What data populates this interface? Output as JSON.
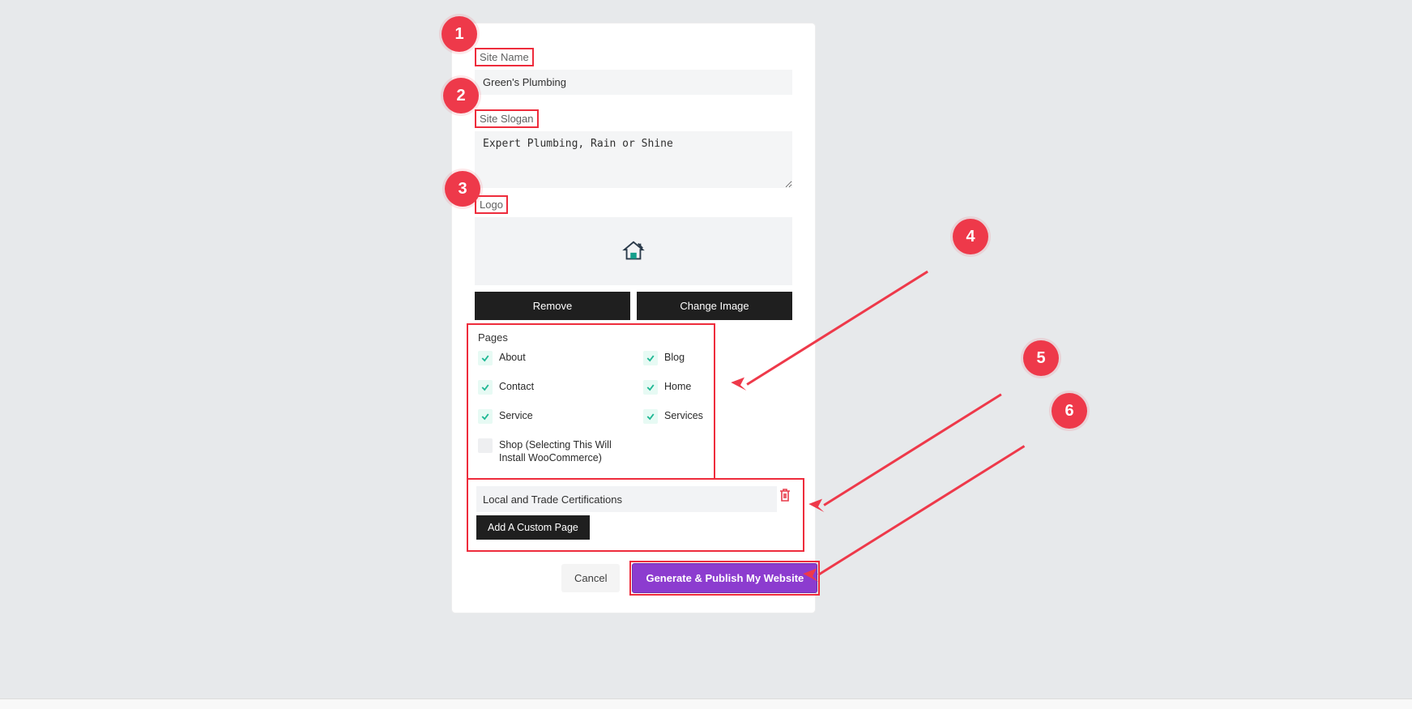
{
  "labels": {
    "site_name": "Site Name",
    "site_slogan": "Site Slogan",
    "logo": "Logo",
    "pages": "Pages"
  },
  "inputs": {
    "site_name_value": "Green's Plumbing",
    "site_slogan_value": "Expert Plumbing, Rain or Shine",
    "custom_page_value": "Local and Trade Certifications"
  },
  "buttons": {
    "remove": "Remove",
    "change_image": "Change Image",
    "add_custom_page": "Add A Custom Page",
    "cancel": "Cancel",
    "generate": "Generate & Publish My Website"
  },
  "pages": {
    "about": "About",
    "contact": "Contact",
    "service": "Service",
    "shop": "Shop (Selecting This Will Install WooCommerce)",
    "blog": "Blog",
    "home": "Home",
    "services": "Services"
  },
  "annotations": {
    "n1": "1",
    "n2": "2",
    "n3": "3",
    "n4": "4",
    "n5": "5",
    "n6": "6"
  },
  "colors": {
    "accent": "#ee2c3c",
    "primary_btn": "#8c3ccf"
  }
}
